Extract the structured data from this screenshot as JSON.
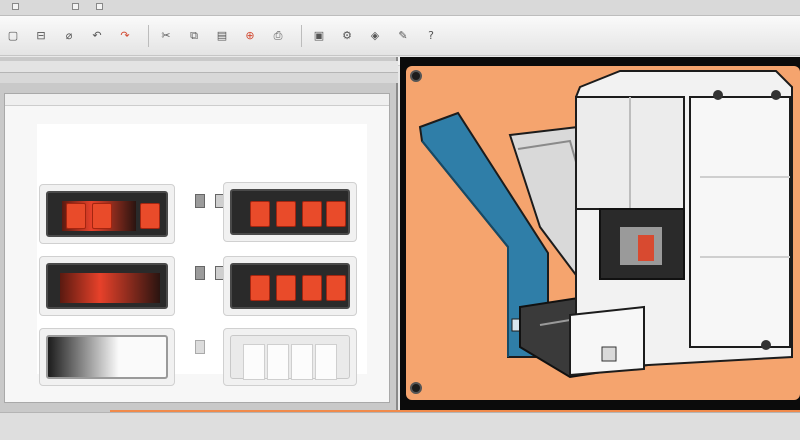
{
  "window": {
    "title": "",
    "controls": [
      "minimize-icon",
      "maximize-icon",
      "close-icon"
    ]
  },
  "toolbar": {
    "icons": [
      "new-file-icon",
      "folder-open-icon",
      "save-icon",
      "undo-icon",
      "redo-icon",
      "cut-icon",
      "copy-icon",
      "paste-icon",
      "zoom-icon",
      "print-icon",
      "shapes-icon",
      "settings-icon",
      "layers-icon",
      "tools-icon",
      "help-icon"
    ],
    "glyphs": [
      "▢",
      "⊟",
      "⌀",
      "↶",
      "↷",
      "✂",
      "⧉",
      "▤",
      "⊕",
      "⎙",
      "▣",
      "⚙",
      "◈",
      "✎",
      "?"
    ]
  },
  "left_pane": {
    "header_text": "",
    "inner_window_title": ""
  },
  "colors": {
    "accent_orange": "#f5a46e",
    "module_red": "#e94b2a",
    "machine_blue": "#2f7ea8",
    "machine_white": "#f2f2f2"
  }
}
